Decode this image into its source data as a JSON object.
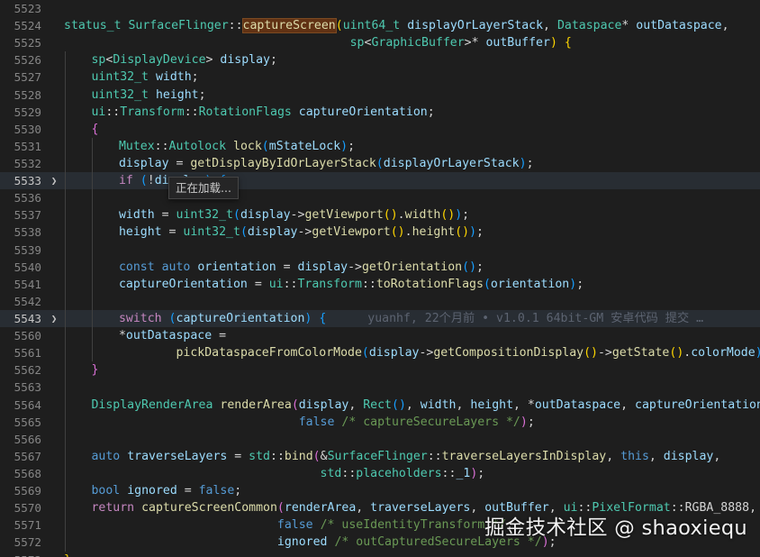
{
  "editor": {
    "colors": {
      "background": "#1e1e1e",
      "keyword": "#569cd6",
      "control": "#c586c0",
      "type": "#4ec9b0",
      "function": "#dcdcaa",
      "variable": "#9cdcfe",
      "comment": "#6a9955"
    },
    "lines": [
      {
        "n": "5523",
        "indent": 0,
        "tokens": []
      },
      {
        "n": "5524",
        "indent": 0,
        "tokens": [
          {
            "t": "status_t",
            "c": "type"
          },
          {
            "t": " ",
            "c": "pl"
          },
          {
            "t": "SurfaceFlinger",
            "c": "type"
          },
          {
            "t": "::",
            "c": "pl"
          },
          {
            "t": "captureScreen",
            "c": "sel"
          },
          {
            "t": "(",
            "c": "br1"
          },
          {
            "t": "uint64_t",
            "c": "type"
          },
          {
            "t": " ",
            "c": "pl"
          },
          {
            "t": "displayOrLayerStack",
            "c": "var"
          },
          {
            "t": ", ",
            "c": "pl"
          },
          {
            "t": "Dataspace",
            "c": "type"
          },
          {
            "t": "* ",
            "c": "pl"
          },
          {
            "t": "outDataspace",
            "c": "var"
          },
          {
            "t": ",",
            "c": "pl"
          }
        ]
      },
      {
        "n": "5525",
        "indent": 0,
        "pad": "                                        ",
        "tokens": [
          {
            "t": "sp",
            "c": "type"
          },
          {
            "t": "<",
            "c": "pl"
          },
          {
            "t": "GraphicBuffer",
            "c": "type"
          },
          {
            "t": ">* ",
            "c": "pl"
          },
          {
            "t": "outBuffer",
            "c": "var"
          },
          {
            "t": ") ",
            "c": "br1"
          },
          {
            "t": "{",
            "c": "br1"
          }
        ]
      },
      {
        "n": "5526",
        "indent": 1,
        "tokens": [
          {
            "t": "sp",
            "c": "type"
          },
          {
            "t": "<",
            "c": "pl"
          },
          {
            "t": "DisplayDevice",
            "c": "type"
          },
          {
            "t": "> ",
            "c": "pl"
          },
          {
            "t": "display",
            "c": "var"
          },
          {
            "t": ";",
            "c": "pl"
          }
        ]
      },
      {
        "n": "5527",
        "indent": 1,
        "tokens": [
          {
            "t": "uint32_t",
            "c": "type"
          },
          {
            "t": " ",
            "c": "pl"
          },
          {
            "t": "width",
            "c": "var"
          },
          {
            "t": ";",
            "c": "pl"
          }
        ]
      },
      {
        "n": "5528",
        "indent": 1,
        "tokens": [
          {
            "t": "uint32_t",
            "c": "type"
          },
          {
            "t": " ",
            "c": "pl"
          },
          {
            "t": "height",
            "c": "var"
          },
          {
            "t": ";",
            "c": "pl"
          }
        ]
      },
      {
        "n": "5529",
        "indent": 1,
        "tokens": [
          {
            "t": "ui",
            "c": "type"
          },
          {
            "t": "::",
            "c": "pl"
          },
          {
            "t": "Transform",
            "c": "type"
          },
          {
            "t": "::",
            "c": "pl"
          },
          {
            "t": "RotationFlags",
            "c": "type"
          },
          {
            "t": " ",
            "c": "pl"
          },
          {
            "t": "captureOrientation",
            "c": "var"
          },
          {
            "t": ";",
            "c": "pl"
          }
        ]
      },
      {
        "n": "5530",
        "indent": 1,
        "tokens": [
          {
            "t": "{",
            "c": "br2"
          }
        ]
      },
      {
        "n": "5531",
        "indent": 2,
        "tokens": [
          {
            "t": "Mutex",
            "c": "type"
          },
          {
            "t": "::",
            "c": "pl"
          },
          {
            "t": "Autolock",
            "c": "type"
          },
          {
            "t": " ",
            "c": "pl"
          },
          {
            "t": "lock",
            "c": "fn"
          },
          {
            "t": "(",
            "c": "br3"
          },
          {
            "t": "mStateLock",
            "c": "var"
          },
          {
            "t": ")",
            "c": "br3"
          },
          {
            "t": ";",
            "c": "pl"
          }
        ]
      },
      {
        "n": "5532",
        "indent": 2,
        "tokens": [
          {
            "t": "display",
            "c": "var"
          },
          {
            "t": " = ",
            "c": "pl"
          },
          {
            "t": "getDisplayByIdOrLayerStack",
            "c": "fn"
          },
          {
            "t": "(",
            "c": "br3"
          },
          {
            "t": "displayOrLayerStack",
            "c": "var"
          },
          {
            "t": ")",
            "c": "br3"
          },
          {
            "t": ";",
            "c": "pl"
          }
        ]
      },
      {
        "n": "5533",
        "indent": 2,
        "fold": true,
        "current": true,
        "tokens": [
          {
            "t": "if",
            "c": "ctl"
          },
          {
            "t": " ",
            "c": "pl"
          },
          {
            "t": "(",
            "c": "br3"
          },
          {
            "t": "!",
            "c": "pl"
          },
          {
            "t": "display",
            "c": "var"
          },
          {
            "t": ")",
            "c": "br3"
          },
          {
            "t": " ",
            "c": "pl"
          },
          {
            "t": "{",
            "c": "br3"
          }
        ]
      },
      {
        "n": "5536",
        "indent": 2,
        "tokens": []
      },
      {
        "n": "5537",
        "indent": 2,
        "tokens": [
          {
            "t": "width",
            "c": "var"
          },
          {
            "t": " = ",
            "c": "pl"
          },
          {
            "t": "uint32_t",
            "c": "type"
          },
          {
            "t": "(",
            "c": "br3"
          },
          {
            "t": "display",
            "c": "var"
          },
          {
            "t": "->",
            "c": "pl"
          },
          {
            "t": "getViewport",
            "c": "fn"
          },
          {
            "t": "()",
            "c": "br1"
          },
          {
            "t": ".",
            "c": "pl"
          },
          {
            "t": "width",
            "c": "fn"
          },
          {
            "t": "()",
            "c": "br1"
          },
          {
            "t": ")",
            "c": "br3"
          },
          {
            "t": ";",
            "c": "pl"
          }
        ]
      },
      {
        "n": "5538",
        "indent": 2,
        "tokens": [
          {
            "t": "height",
            "c": "var"
          },
          {
            "t": " = ",
            "c": "pl"
          },
          {
            "t": "uint32_t",
            "c": "type"
          },
          {
            "t": "(",
            "c": "br3"
          },
          {
            "t": "display",
            "c": "var"
          },
          {
            "t": "->",
            "c": "pl"
          },
          {
            "t": "getViewport",
            "c": "fn"
          },
          {
            "t": "()",
            "c": "br1"
          },
          {
            "t": ".",
            "c": "pl"
          },
          {
            "t": "height",
            "c": "fn"
          },
          {
            "t": "()",
            "c": "br1"
          },
          {
            "t": ")",
            "c": "br3"
          },
          {
            "t": ";",
            "c": "pl"
          }
        ]
      },
      {
        "n": "5539",
        "indent": 2,
        "tokens": []
      },
      {
        "n": "5540",
        "indent": 2,
        "tokens": [
          {
            "t": "const",
            "c": "kw"
          },
          {
            "t": " ",
            "c": "pl"
          },
          {
            "t": "auto",
            "c": "kw"
          },
          {
            "t": " ",
            "c": "pl"
          },
          {
            "t": "orientation",
            "c": "var"
          },
          {
            "t": " = ",
            "c": "pl"
          },
          {
            "t": "display",
            "c": "var"
          },
          {
            "t": "->",
            "c": "pl"
          },
          {
            "t": "getOrientation",
            "c": "fn"
          },
          {
            "t": "()",
            "c": "br3"
          },
          {
            "t": ";",
            "c": "pl"
          }
        ]
      },
      {
        "n": "5541",
        "indent": 2,
        "tokens": [
          {
            "t": "captureOrientation",
            "c": "var"
          },
          {
            "t": " = ",
            "c": "pl"
          },
          {
            "t": "ui",
            "c": "type"
          },
          {
            "t": "::",
            "c": "pl"
          },
          {
            "t": "Transform",
            "c": "type"
          },
          {
            "t": "::",
            "c": "pl"
          },
          {
            "t": "toRotationFlags",
            "c": "fn"
          },
          {
            "t": "(",
            "c": "br3"
          },
          {
            "t": "orientation",
            "c": "var"
          },
          {
            "t": ")",
            "c": "br3"
          },
          {
            "t": ";",
            "c": "pl"
          }
        ]
      },
      {
        "n": "5542",
        "indent": 2,
        "tokens": []
      },
      {
        "n": "5543",
        "indent": 2,
        "fold": true,
        "current": true,
        "blame": "yuanhf, 22个月前 • v1.0.1 64bit-GM 安卓代码 提交 …",
        "tokens": [
          {
            "t": "switch",
            "c": "ctl"
          },
          {
            "t": " ",
            "c": "pl"
          },
          {
            "t": "(",
            "c": "br3"
          },
          {
            "t": "captureOrientation",
            "c": "var"
          },
          {
            "t": ")",
            "c": "br3"
          },
          {
            "t": " ",
            "c": "pl"
          },
          {
            "t": "{",
            "c": "br3"
          }
        ]
      },
      {
        "n": "5560",
        "indent": 2,
        "tokens": [
          {
            "t": "*",
            "c": "pl"
          },
          {
            "t": "outDataspace",
            "c": "var"
          },
          {
            "t": " =",
            "c": "pl"
          }
        ]
      },
      {
        "n": "5561",
        "indent": 2,
        "pad": "        ",
        "tokens": [
          {
            "t": "pickDataspaceFromColorMode",
            "c": "fn"
          },
          {
            "t": "(",
            "c": "br3"
          },
          {
            "t": "display",
            "c": "var"
          },
          {
            "t": "->",
            "c": "pl"
          },
          {
            "t": "getCompositionDisplay",
            "c": "fn"
          },
          {
            "t": "()",
            "c": "br1"
          },
          {
            "t": "->",
            "c": "pl"
          },
          {
            "t": "getState",
            "c": "fn"
          },
          {
            "t": "()",
            "c": "br1"
          },
          {
            "t": ".",
            "c": "pl"
          },
          {
            "t": "colorMode",
            "c": "var"
          },
          {
            "t": ")",
            "c": "br3"
          },
          {
            "t": ";",
            "c": "pl"
          }
        ]
      },
      {
        "n": "5562",
        "indent": 1,
        "tokens": [
          {
            "t": "}",
            "c": "br2"
          }
        ]
      },
      {
        "n": "5563",
        "indent": 1,
        "tokens": []
      },
      {
        "n": "5564",
        "indent": 1,
        "tokens": [
          {
            "t": "DisplayRenderArea",
            "c": "type"
          },
          {
            "t": " ",
            "c": "pl"
          },
          {
            "t": "renderArea",
            "c": "fn"
          },
          {
            "t": "(",
            "c": "br2"
          },
          {
            "t": "display",
            "c": "var"
          },
          {
            "t": ", ",
            "c": "pl"
          },
          {
            "t": "Rect",
            "c": "type"
          },
          {
            "t": "()",
            "c": "br3"
          },
          {
            "t": ", ",
            "c": "pl"
          },
          {
            "t": "width",
            "c": "var"
          },
          {
            "t": ", ",
            "c": "pl"
          },
          {
            "t": "height",
            "c": "var"
          },
          {
            "t": ", *",
            "c": "pl"
          },
          {
            "t": "outDataspace",
            "c": "var"
          },
          {
            "t": ", ",
            "c": "pl"
          },
          {
            "t": "captureOrientation",
            "c": "var"
          },
          {
            "t": ",",
            "c": "pl"
          }
        ]
      },
      {
        "n": "5565",
        "indent": 1,
        "pad": "                             ",
        "tokens": [
          {
            "t": "false",
            "c": "kw"
          },
          {
            "t": " ",
            "c": "pl"
          },
          {
            "t": "/* captureSecureLayers */",
            "c": "cm"
          },
          {
            "t": ")",
            "c": "br2"
          },
          {
            "t": ";",
            "c": "pl"
          }
        ]
      },
      {
        "n": "5566",
        "indent": 1,
        "tokens": []
      },
      {
        "n": "5567",
        "indent": 1,
        "tokens": [
          {
            "t": "auto",
            "c": "kw"
          },
          {
            "t": " ",
            "c": "pl"
          },
          {
            "t": "traverseLayers",
            "c": "var"
          },
          {
            "t": " = ",
            "c": "pl"
          },
          {
            "t": "std",
            "c": "type"
          },
          {
            "t": "::",
            "c": "pl"
          },
          {
            "t": "bind",
            "c": "fn"
          },
          {
            "t": "(",
            "c": "br2"
          },
          {
            "t": "&",
            "c": "pl"
          },
          {
            "t": "SurfaceFlinger",
            "c": "type"
          },
          {
            "t": "::",
            "c": "pl"
          },
          {
            "t": "traverseLayersInDisplay",
            "c": "fn"
          },
          {
            "t": ", ",
            "c": "pl"
          },
          {
            "t": "this",
            "c": "kw"
          },
          {
            "t": ", ",
            "c": "pl"
          },
          {
            "t": "display",
            "c": "var"
          },
          {
            "t": ",",
            "c": "pl"
          }
        ]
      },
      {
        "n": "5568",
        "indent": 1,
        "pad": "                                ",
        "tokens": [
          {
            "t": "std",
            "c": "type"
          },
          {
            "t": "::",
            "c": "pl"
          },
          {
            "t": "placeholders",
            "c": "type"
          },
          {
            "t": "::",
            "c": "pl"
          },
          {
            "t": "_1",
            "c": "var"
          },
          {
            "t": ")",
            "c": "br2"
          },
          {
            "t": ";",
            "c": "pl"
          }
        ]
      },
      {
        "n": "5569",
        "indent": 1,
        "tokens": [
          {
            "t": "bool",
            "c": "kw"
          },
          {
            "t": " ",
            "c": "pl"
          },
          {
            "t": "ignored",
            "c": "var"
          },
          {
            "t": " = ",
            "c": "pl"
          },
          {
            "t": "false",
            "c": "kw"
          },
          {
            "t": ";",
            "c": "pl"
          }
        ]
      },
      {
        "n": "5570",
        "indent": 1,
        "tokens": [
          {
            "t": "return",
            "c": "ctl"
          },
          {
            "t": " ",
            "c": "pl"
          },
          {
            "t": "captureScreenCommon",
            "c": "fn"
          },
          {
            "t": "(",
            "c": "br2"
          },
          {
            "t": "renderArea",
            "c": "var"
          },
          {
            "t": ", ",
            "c": "pl"
          },
          {
            "t": "traverseLayers",
            "c": "var"
          },
          {
            "t": ", ",
            "c": "pl"
          },
          {
            "t": "outBuffer",
            "c": "var"
          },
          {
            "t": ", ",
            "c": "pl"
          },
          {
            "t": "ui",
            "c": "type"
          },
          {
            "t": "::",
            "c": "pl"
          },
          {
            "t": "PixelFormat",
            "c": "type"
          },
          {
            "t": "::",
            "c": "pl"
          },
          {
            "t": "RGBA_8888",
            "c": "pl"
          },
          {
            "t": ",",
            "c": "pl"
          }
        ]
      },
      {
        "n": "5571",
        "indent": 1,
        "pad": "                          ",
        "tokens": [
          {
            "t": "false",
            "c": "kw"
          },
          {
            "t": " ",
            "c": "pl"
          },
          {
            "t": "/* useIdentityTransform */",
            "c": "cm"
          },
          {
            "t": ",",
            "c": "pl"
          }
        ]
      },
      {
        "n": "5572",
        "indent": 1,
        "pad": "                          ",
        "tokens": [
          {
            "t": "ignored",
            "c": "var"
          },
          {
            "t": " ",
            "c": "pl"
          },
          {
            "t": "/* outCapturedSecureLayers */",
            "c": "cm"
          },
          {
            "t": ")",
            "c": "br2"
          },
          {
            "t": ";",
            "c": "pl"
          }
        ]
      },
      {
        "n": "5573",
        "indent": 0,
        "tokens": [
          {
            "t": "}",
            "c": "br1"
          }
        ]
      }
    ]
  },
  "hover": {
    "text": "正在加载..."
  },
  "watermark": {
    "text": "掘金技术社区 @ shaoxiequ"
  }
}
